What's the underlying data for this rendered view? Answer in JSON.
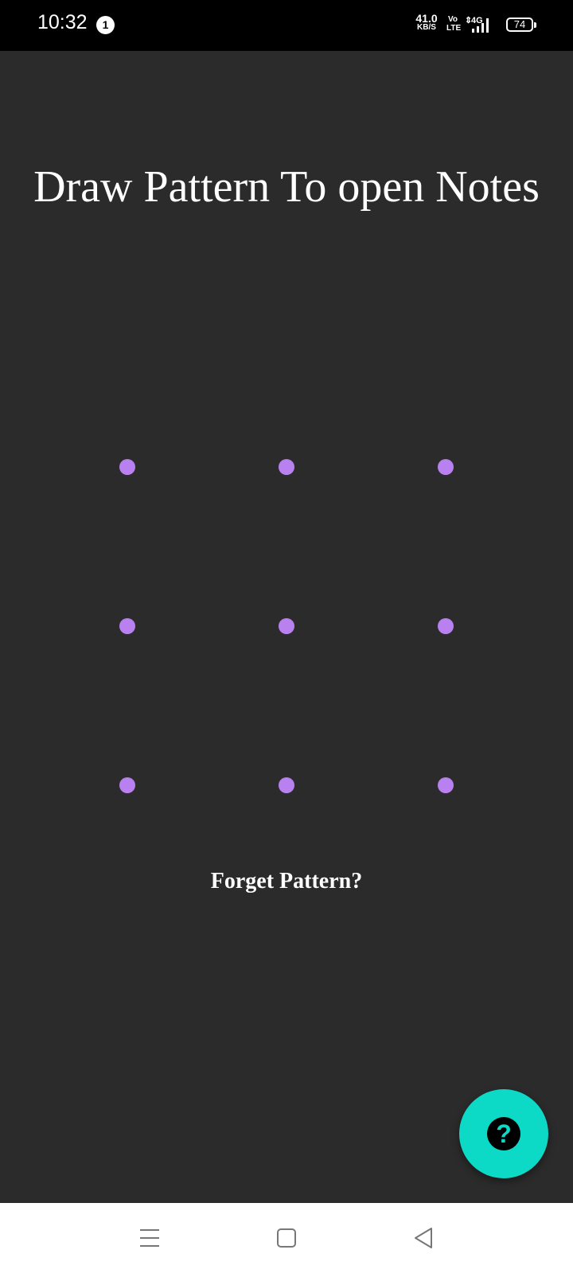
{
  "status_bar": {
    "time": "10:32",
    "notification_count": "1",
    "net_speed_value": "41.0",
    "net_speed_unit": "KB/S",
    "volte_top": "Vo",
    "volte_bottom": "LTE",
    "network_type": "4G",
    "battery_level": "74"
  },
  "main": {
    "title": "Draw Pattern To open Notes",
    "forget_pattern_label": "Forget Pattern?",
    "pattern_grid": {
      "rows": 3,
      "cols": 3,
      "dot_color": "#b981f0"
    }
  },
  "fab": {
    "icon": "help-icon",
    "glyph": "?",
    "color": "#0dd9c7"
  },
  "navigation": {
    "buttons": [
      "menu-icon",
      "home-icon",
      "back-icon"
    ]
  },
  "colors": {
    "background": "#2b2b2b",
    "status_bar": "#000000",
    "nav_bar": "#ffffff"
  }
}
